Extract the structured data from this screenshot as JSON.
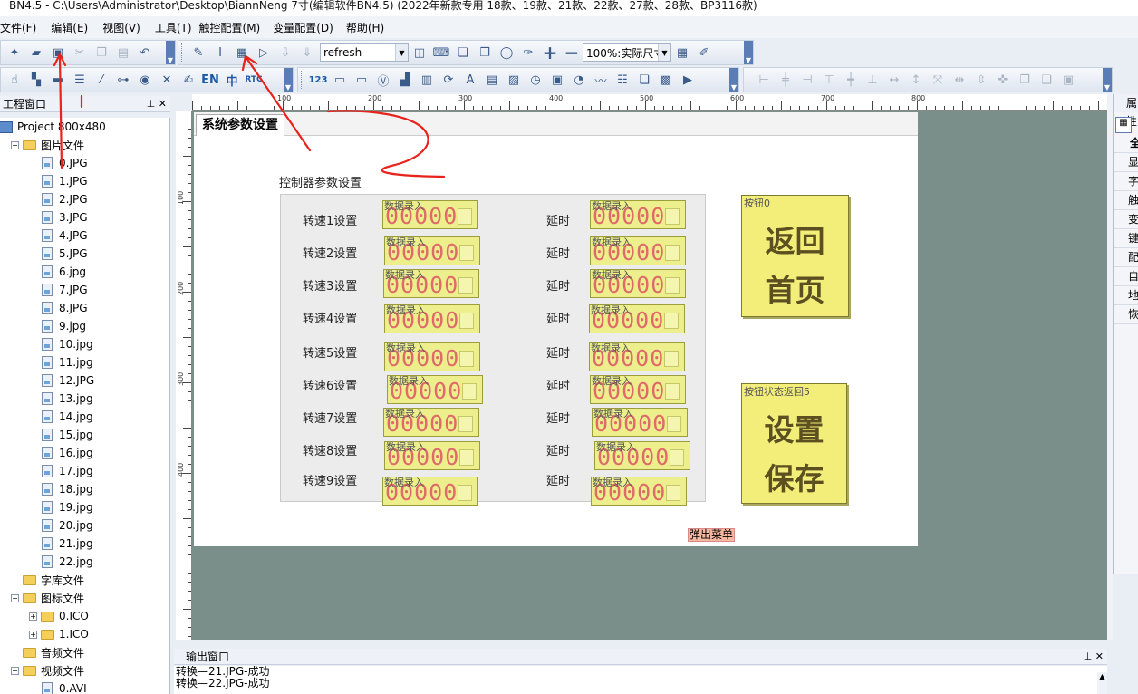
{
  "window": {
    "title": "BN4.5 - C:\\Users\\Administrator\\Desktop\\BiannNeng 7寸(编辑软件BN4.5) (2022年新款专用 18款、19款、21款、22款、27款、28款、BP3116款)"
  },
  "menu": [
    "文件(F)",
    "编辑(E)",
    "视图(V)",
    "工具(T)",
    "触控配置(M)",
    "变量配置(D)",
    "帮助(H)"
  ],
  "toolbar": {
    "combo_value": "refresh",
    "zoom_value": "100%:实际尺寸",
    "icons1": [
      "new-file-icon",
      "open-folder-icon",
      "save-icon",
      "cut-icon",
      "copy-icon",
      "paste-icon",
      "undo-icon",
      "wrench-icon",
      "text-tool-icon",
      "grid-tool-icon",
      "page-tool-icon",
      "import-icon",
      "download-icon"
    ],
    "icons2": [
      "preview-icon",
      "keyboard-icon",
      "window-icon",
      "window2-icon",
      "zoom-icon",
      "eyedropper-icon",
      "plus-icon",
      "minus-icon",
      "calculator-icon",
      "paint-icon"
    ],
    "row2_text": {
      "en": "EN",
      "zh": "中",
      "rtc": "RTC",
      "n123": "123"
    }
  },
  "project_panel": {
    "title": "工程窗口",
    "project_name": "Project 800x480",
    "folders": {
      "images": "图片文件",
      "fonts": "字库文件",
      "icons": "图标文件",
      "audio": "音频文件",
      "video": "视频文件"
    },
    "image_files": [
      "0.JPG",
      "1.JPG",
      "2.JPG",
      "3.JPG",
      "4.JPG",
      "5.JPG",
      "6.jpg",
      "7.JPG",
      "8.JPG",
      "9.jpg",
      "10.jpg",
      "11.jpg",
      "12.JPG",
      "13.jpg",
      "14.jpg",
      "15.jpg",
      "16.jpg",
      "17.jpg",
      "18.jpg",
      "19.jpg",
      "20.jpg",
      "21.jpg",
      "22.jpg"
    ],
    "icon_files": [
      "0.ICO",
      "1.ICO"
    ],
    "video_files": [
      "0.AVI"
    ]
  },
  "ruler": {
    "h": [
      "100",
      "200",
      "300",
      "400",
      "500",
      "600",
      "700",
      "800"
    ],
    "v": [
      "100",
      "200",
      "300",
      "400"
    ]
  },
  "page": {
    "tab_title": "系统参数设置",
    "section_title": "控制器参数设置",
    "speed_labels": [
      "转速1设置",
      "转速2设置",
      "转速3设置",
      "转速4设置",
      "转速5设置",
      "转速6设置",
      "转速7设置",
      "转速8设置",
      "转速9设置"
    ],
    "delay_label": "延时",
    "input_tag": "数据录入",
    "input_digits": "00000",
    "button_home": {
      "tag": "按钮0",
      "line1": "返回",
      "line2": "首页"
    },
    "button_save": {
      "tag": "按钮状态返回5",
      "line1": "设置",
      "line2": "保存"
    },
    "popup_menu": "弹出菜单"
  },
  "output_panel": {
    "title": "输出窗口",
    "lines": [
      "转换—21.JPG-成功",
      "转换—22.JPG-成功"
    ]
  },
  "props_panel": {
    "title": "属性",
    "rows": [
      "全",
      "显",
      "字",
      "触",
      "变",
      "键",
      "配",
      "自",
      "地",
      "恢"
    ]
  },
  "colors": {
    "accent": "#5a7db5",
    "annotation": "#e8231c",
    "input_fill": "#ecef8c",
    "button_fill": "#f3ee7a",
    "work_bg": "#7b8f8a"
  }
}
